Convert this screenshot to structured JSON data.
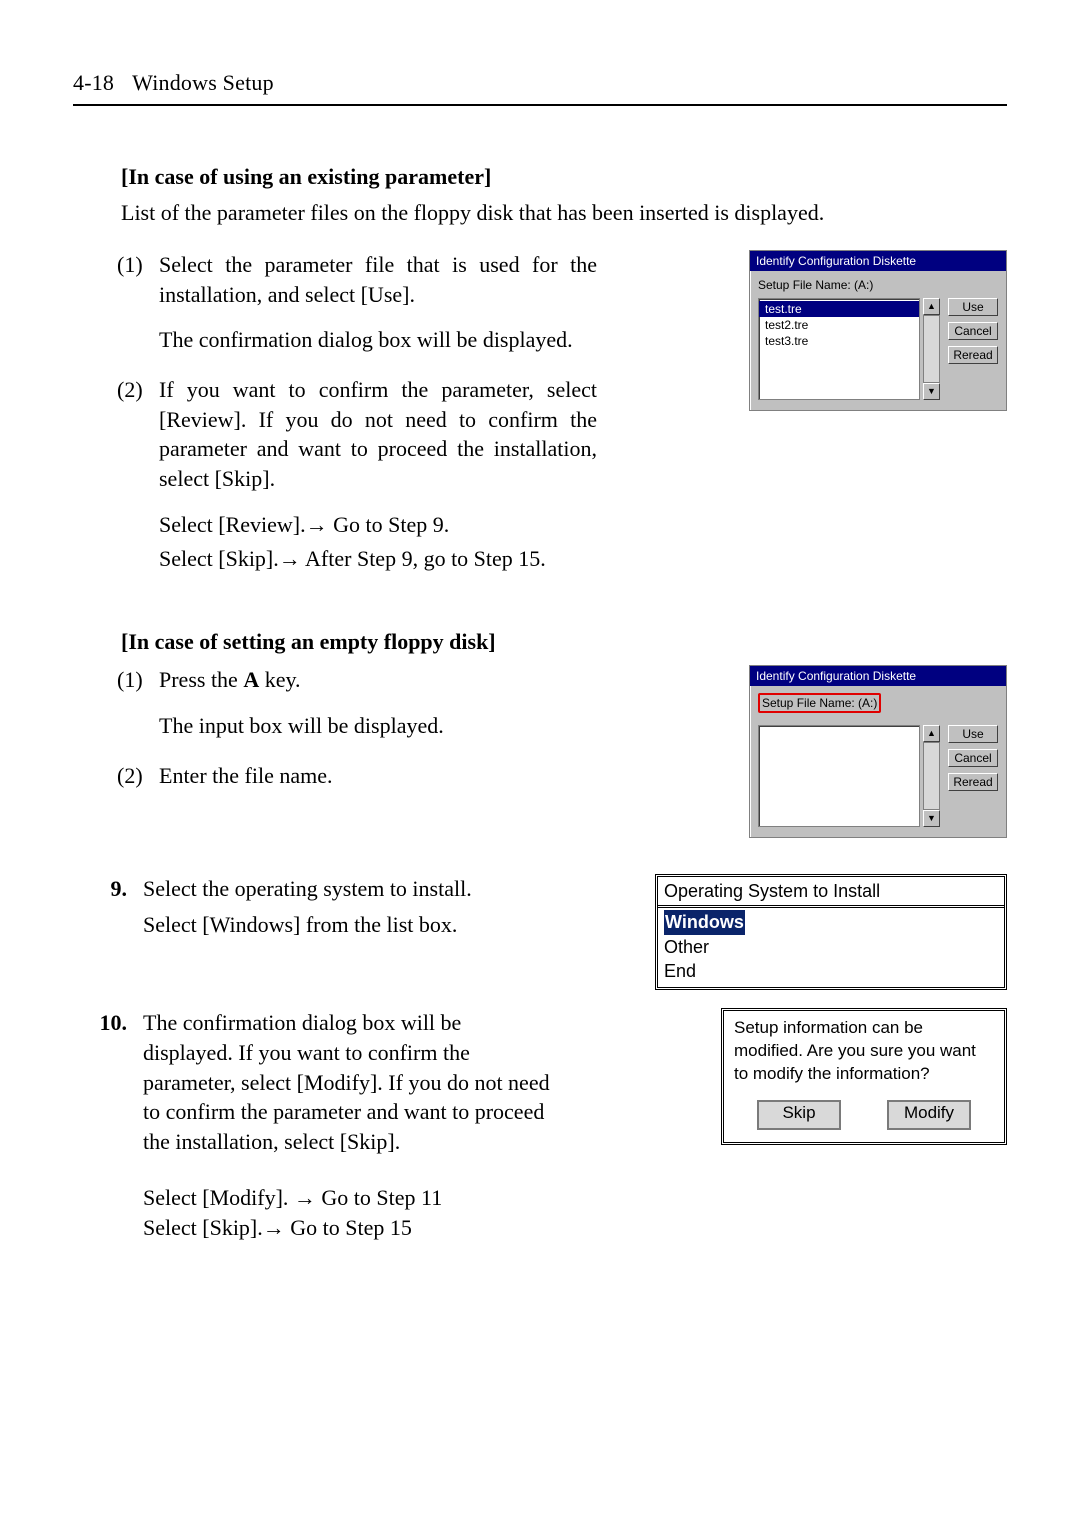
{
  "header": {
    "page_no": "4-18",
    "title": "Windows Setup"
  },
  "section1": {
    "heading": "[In case of using an existing parameter]",
    "intro": "List of the parameter files on the floppy disk that has been inserted is displayed.",
    "items": [
      {
        "num": "(1)",
        "text": "Select the parameter file that is used for the installation, and select [Use].",
        "sub": "The confirmation dialog box will be displayed."
      },
      {
        "num": "(2)",
        "text": "If you want to confirm the parameter, select [Review]. If you do not need to confirm the parameter and want to proceed the installation, select [Skip].",
        "sub1": "Select [Review].→ Go to Step 9.",
        "sub2": "Select [Skip].→ After Step 9, go to Step 15."
      }
    ]
  },
  "diskette1": {
    "title": "Identify Configuration Diskette",
    "label": "Setup File Name: (A:)",
    "files": [
      "test.tre",
      "test2.tre",
      "test3.tre"
    ],
    "buttons": {
      "use": "Use",
      "cancel": "Cancel",
      "reread": "Reread"
    }
  },
  "section2": {
    "heading": "[In case of setting an empty floppy disk]",
    "items": [
      {
        "num": "(1)",
        "text_prefix": "Press the ",
        "kbd": "A",
        "text_suffix": " key.",
        "sub": "The input box will be displayed."
      },
      {
        "num": "(2)",
        "text": "Enter the file name."
      }
    ]
  },
  "diskette2": {
    "title": "Identify Configuration Diskette",
    "label": "Setup File Name: (A:)",
    "buttons": {
      "use": "Use",
      "cancel": "Cancel",
      "reread": "Reread"
    }
  },
  "step9": {
    "num": "9.",
    "line1": "Select the operating system to install.",
    "line2": "Select [Windows] from the list box."
  },
  "os_box": {
    "title": "Operating System to Install",
    "items": [
      "Windows",
      "Other",
      "End"
    ]
  },
  "step10": {
    "num": "10.",
    "text": "The confirmation dialog box will be displayed. If you want to confirm the parameter, select [Modify]. If you do not need to confirm the parameter and want to proceed the installation, select [Skip].",
    "sub1": "Select [Modify]. →  Go to Step 11",
    "sub2": "Select [Skip].→  Go to Step 15"
  },
  "confirm_box": {
    "text": "Setup information can be modified. Are you sure you want to modify the information?",
    "skip": "Skip",
    "modify": "Modify"
  }
}
